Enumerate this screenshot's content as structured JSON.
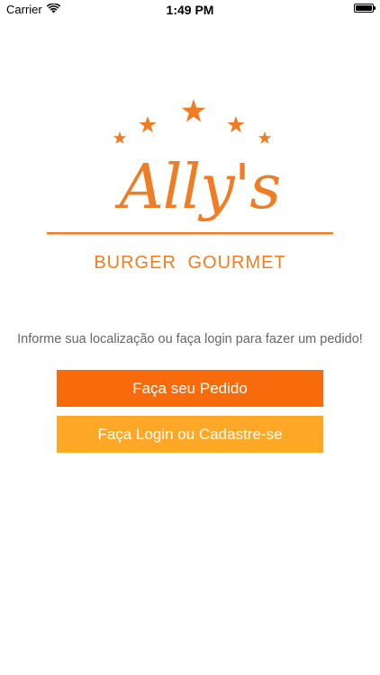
{
  "status_bar": {
    "carrier": "Carrier",
    "time": "1:49 PM",
    "wifi_icon": "wifi-icon",
    "battery_icon": "battery-icon",
    "battery_level": 1.0
  },
  "logo": {
    "script_name": "Ally's",
    "subtitle": "BURGER GOURMET",
    "star_count": 5,
    "color": "#F07C24"
  },
  "prompt": {
    "text": "Informe sua localização ou faça login para fazer um pedido!"
  },
  "buttons": {
    "order_label": "Faça seu Pedido",
    "order_color": "#F76B0C",
    "login_label": "Faça Login ou Cadastre-se",
    "login_color": "#FFA726"
  }
}
